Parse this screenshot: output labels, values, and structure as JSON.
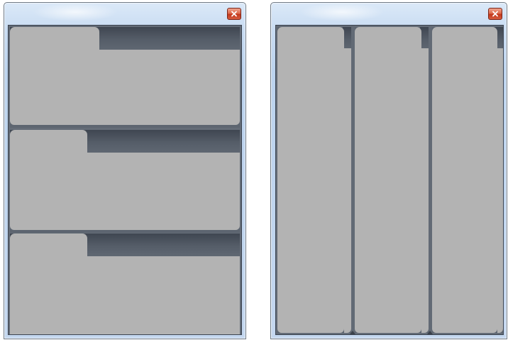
{
  "windows": [
    {
      "id": "left",
      "layout": "horizontal-stacked",
      "close_icon": "close-icon",
      "panels": [
        {
          "id": "panel-1"
        },
        {
          "id": "panel-2"
        },
        {
          "id": "panel-3"
        }
      ]
    },
    {
      "id": "right",
      "layout": "vertical-columns",
      "close_icon": "close-icon",
      "panels": [
        {
          "id": "panel-1"
        },
        {
          "id": "panel-2"
        },
        {
          "id": "panel-3"
        }
      ]
    }
  ],
  "colors": {
    "panel_fill": "#b3b3b3",
    "strip_dark": "#3f4651",
    "client_bg": "#646c77",
    "frame_glass": "#c4d7ef",
    "close_button": "#c2381c"
  }
}
